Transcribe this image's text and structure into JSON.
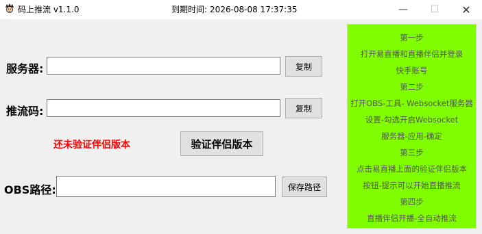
{
  "window": {
    "title": "码上推流  v1.1.0",
    "expiry_label": "到期时间:",
    "expiry_value": "2026-08-08 17:37:35",
    "minimize_glyph": "—",
    "maximize_glyph": "☐",
    "close_glyph": "✕"
  },
  "form": {
    "server_label": "服务器:",
    "server_value": "",
    "server_copy_label": "复制",
    "push_code_label": "推流码:",
    "push_code_value": "",
    "push_code_copy_label": "复制",
    "status_text": "还未验证伴侣版本",
    "verify_button_label": "验证伴侣版本",
    "obs_path_label": "OBS路径:",
    "obs_path_value": "",
    "save_path_label": "保存路径"
  },
  "guide": {
    "lines": [
      "第一步",
      "打开易直播和直播伴侣并登录",
      "快手账号",
      "第二步",
      "打开OBS-工具- Websocket服务器",
      "设置-勾选开启Websocket",
      "服务器-应用-确定",
      "第三步",
      "点击易直播上面的验证伴侣版本",
      "按钮-提示可以开始直播推流",
      "第四步",
      "直播伴侣开播-全自动推流"
    ]
  },
  "colors": {
    "guide_background": "#80ff00",
    "status_text": "#ff0000"
  },
  "icons": {
    "app": "app-logo-icon",
    "minimize": "minimize-icon",
    "maximize": "maximize-icon",
    "close": "close-icon"
  }
}
